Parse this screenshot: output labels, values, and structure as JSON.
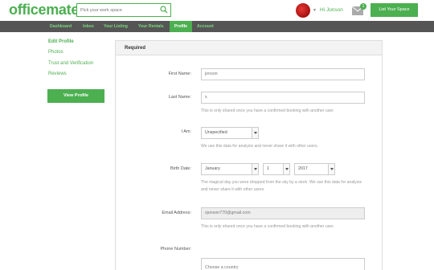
{
  "header": {
    "logo": "officemate",
    "search_placeholder": "Pick your work space",
    "greeting": "Hi Jonson",
    "mail_count": "1",
    "list_button": "List Your Space"
  },
  "nav": {
    "items": [
      "Dashboard",
      "Inbox",
      "Your Listing",
      "Your Rentals",
      "Profile",
      "Account"
    ],
    "active": "Profile"
  },
  "sidebar": {
    "links": [
      "Edit Profile",
      "Photos",
      "Trust and Verification",
      "Reviews"
    ],
    "view_profile": "View Profile"
  },
  "panel": {
    "title": "Required",
    "first_name_label": "First Name:",
    "first_name_value": "jonson",
    "last_name_label": "Last Name:",
    "last_name_value": "s",
    "last_name_help": "This is only shared once you have a confirmed booking with another user.",
    "iam_label": "I Am:",
    "iam_value": "Unspecified",
    "iam_help": "We use this data for analysis and never share it with other users.",
    "birth_label": "Birth Date:",
    "birth_month": "January",
    "birth_day": "1",
    "birth_year": "2017",
    "birth_help_1": "The magical day you were dropped from the sky by a stork. We use this data for analysis",
    "birth_help_2": "and never share it with other users.",
    "email_label": "Email Address:",
    "email_value": "sjonson770@gmail.com",
    "email_help": "This is only shared once you have a confirmed booking with another user.",
    "phone_label": "Phone Number:",
    "country_placeholder": "Choose a country"
  },
  "colors": {
    "brand": "#4caf50",
    "nav_bg": "#555555"
  }
}
